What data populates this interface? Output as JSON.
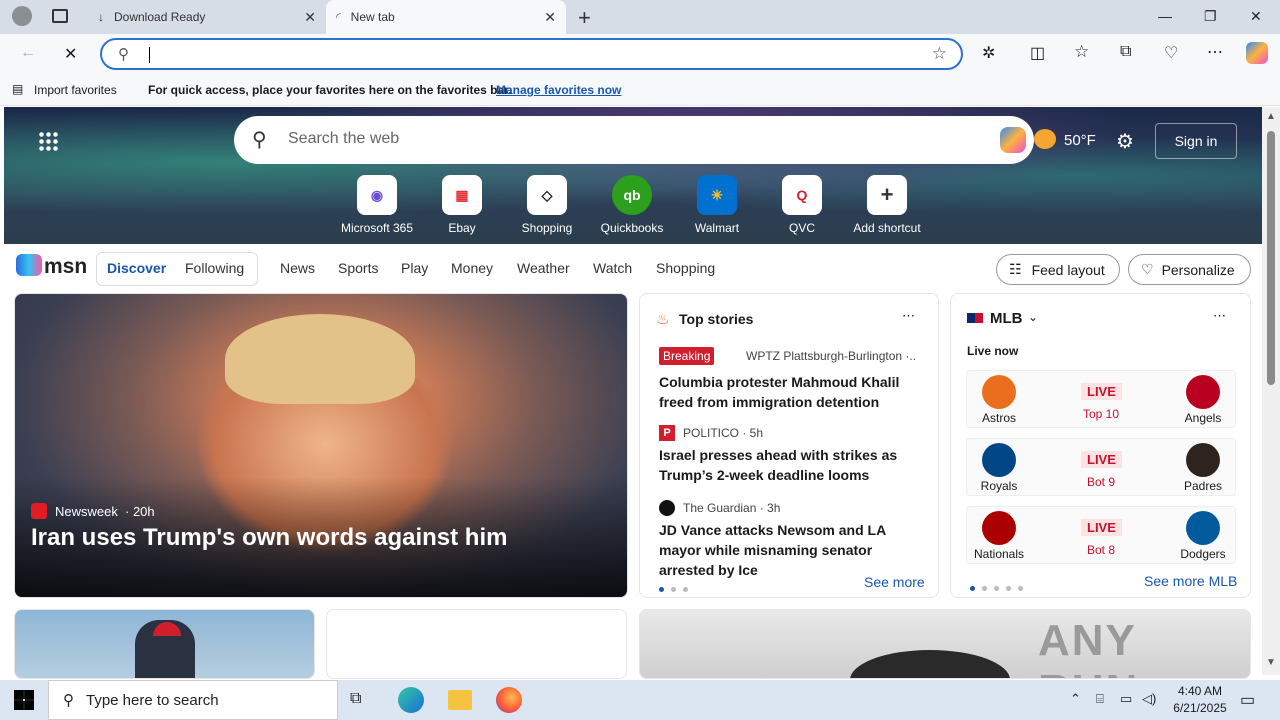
{
  "browser": {
    "tabs": [
      {
        "label": "Download Ready"
      },
      {
        "label": "New tab"
      }
    ],
    "address_value": "",
    "favbar": {
      "import_label": "Import favorites",
      "hint": "For quick access, place your favorites here on the favorites bar.",
      "manage_link": "Manage favorites now"
    }
  },
  "msn": {
    "search_placeholder": "Search the web",
    "weather": "50°F",
    "sign_in": "Sign in",
    "shortcuts": [
      {
        "label": "Microsoft 365"
      },
      {
        "label": "Ebay"
      },
      {
        "label": "Shopping"
      },
      {
        "label": "Quickbooks"
      },
      {
        "label": "Walmart"
      },
      {
        "label": "QVC"
      },
      {
        "label": "Add shortcut"
      }
    ],
    "brand": "msn",
    "nav": [
      "Discover",
      "Following",
      "News",
      "Sports",
      "Play",
      "Money",
      "Weather",
      "Watch",
      "Shopping"
    ],
    "feed_layout": "Feed layout",
    "personalize": "Personalize"
  },
  "hero_story": {
    "source": "Newsweek",
    "age": "· 20h",
    "headline": "Iran uses Trump's own words against him"
  },
  "top_stories": {
    "title": "Top stories",
    "items": [
      {
        "badge": "Breaking",
        "source": "WPTZ Plattsburgh-Burlington ·...",
        "headline": "Columbia protester Mahmoud Khalil freed from immigration detention"
      },
      {
        "source": "POLITICO · 5h",
        "headline": "Israel presses ahead with strikes as Trump’s 2-week deadline looms"
      },
      {
        "source": "The Guardian · 3h",
        "headline": "JD Vance attacks Newsom and LA mayor while misnaming senator arrested by Ice"
      }
    ],
    "see_more": "See more"
  },
  "mlb": {
    "title": "MLB",
    "live_now": "Live now",
    "live": "LIVE",
    "games": [
      {
        "home": "Astros",
        "away": "Angels",
        "inning": "Top 10"
      },
      {
        "home": "Royals",
        "away": "Padres",
        "inning": "Bot 9"
      },
      {
        "home": "Nationals",
        "away": "Dodgers",
        "inning": "Bot 8"
      }
    ],
    "see_more": "See more MLB"
  },
  "watermark": "ANY RUN",
  "taskbar": {
    "search_placeholder": "Type here to search",
    "time": "4:40 AM",
    "date": "6/21/2025"
  }
}
